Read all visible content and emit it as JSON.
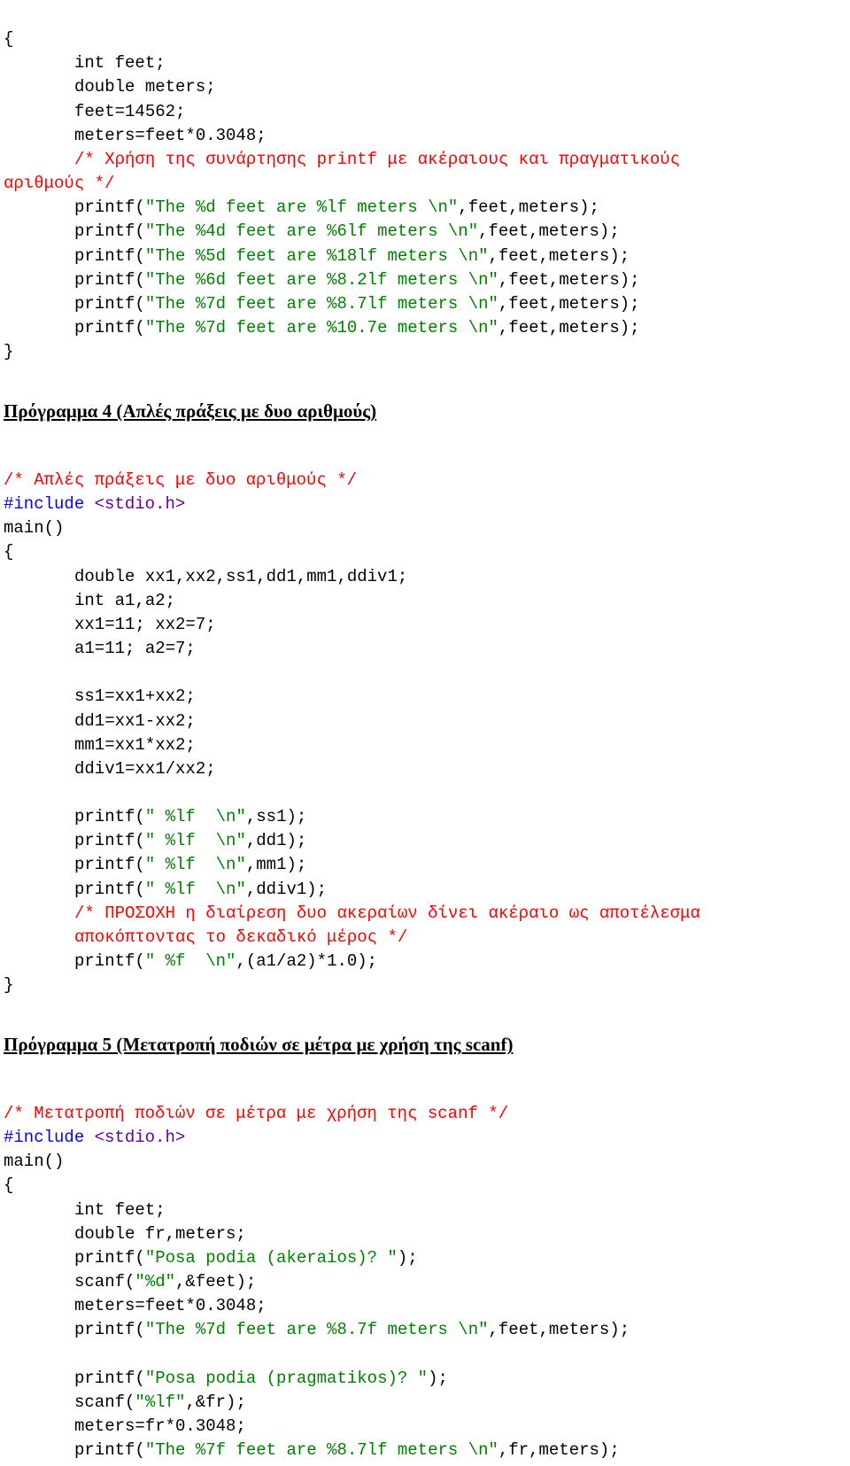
{
  "block1": {
    "open": "{",
    "l1": "int feet;",
    "l2": "double meters;",
    "l3": "feet=14562;",
    "l4": "meters=feet*0.3048;",
    "c1a": "/* Χρήση της συνάρτησης printf με ακέραιους και πραγματικούς",
    "c1b": "αριθμούς */",
    "l5a": "printf(",
    "l5b": "\"The %d feet are %lf meters \\n\"",
    "l5c": ",feet,meters);",
    "l6a": "printf(",
    "l6b": "\"The %4d feet are %6lf meters \\n\"",
    "l6c": ",feet,meters);",
    "l7a": "printf(",
    "l7b": "\"The %5d feet are %18lf meters \\n\"",
    "l7c": ",feet,meters);",
    "l8a": "printf(",
    "l8b": "\"The %6d feet are %8.2lf meters \\n\"",
    "l8c": ",feet,meters);",
    "l9a": "printf(",
    "l9b": "\"The %7d feet are %8.7lf meters \\n\"",
    "l9c": ",feet,meters);",
    "l10a": "printf(",
    "l10b": "\"The %7d feet are %10.7e meters \\n\"",
    "l10c": ",feet,meters);",
    "close": "}"
  },
  "heading4": "Πρόγραμμα 4 (Απλές πράξεις με δυο αριθμούς)",
  "block2": {
    "c1": "/* Απλές πράξεις με δυο αριθμούς */",
    "inc1": "#include ",
    "inc2": "<stdio.h>",
    "main": "main()",
    "open": "{",
    "l1": "double xx1,xx2,ss1,dd1,mm1,ddiv1;",
    "l2": "int a1,a2;",
    "l3": "xx1=11; xx2=7;",
    "l4": "a1=11; a2=7;",
    "l5": "ss1=xx1+xx2;",
    "l6": "dd1=xx1-xx2;",
    "l7": "mm1=xx1*xx2;",
    "l8": "ddiv1=xx1/xx2;",
    "p1a": "printf(",
    "p1b": "\" %lf  \\n\"",
    "p1c": ",ss1);",
    "p2a": "printf(",
    "p2b": "\" %lf  \\n\"",
    "p2c": ",dd1);",
    "p3a": "printf(",
    "p3b": "\" %lf  \\n\"",
    "p3c": ",mm1);",
    "p4a": "printf(",
    "p4b": "\" %lf  \\n\"",
    "p4c": ",ddiv1);",
    "c2a": "/* ΠΡΟΣΟΧΗ η διαίρεση δυο ακεραίων δίνει ακέραιο ως αποτέλεσμα",
    "c2b": "αποκόπτοντας το δεκαδικό μέρος */",
    "p5a": "printf(",
    "p5b": "\" %f  \\n\"",
    "p5c": ",(a1/a2)*1.0);",
    "close": "}"
  },
  "heading5": "Πρόγραμμα 5 (Μετατροπή ποδιών σε μέτρα με χρήση της scanf)",
  "block3": {
    "c1": "/* Μετατροπή ποδιών σε μέτρα με χρήση της scanf */",
    "inc1": "#include ",
    "inc2": "<stdio.h>",
    "main": "main()",
    "open": "{",
    "l1": "int feet;",
    "l2": "double fr,meters;",
    "p1a": "printf(",
    "p1b": "\"Posa podia (akeraios)? \"",
    "p1c": ");",
    "s1a": "scanf(",
    "s1b": "\"%d\"",
    "s1c": ",&feet);",
    "l3": "meters=feet*0.3048;",
    "p2a": "printf(",
    "p2b": "\"The %7d feet are %8.7f meters \\n\"",
    "p2c": ",feet,meters);",
    "p3a": "printf(",
    "p3b": "\"Posa podia (pragmatikos)? \"",
    "p3c": ");",
    "s2a": "scanf(",
    "s2b": "\"%lf\"",
    "s2c": ",&fr);",
    "l4": "meters=fr*0.3048;",
    "p4a": "printf(",
    "p4b": "\"The %7f feet are %8.7lf meters \\n\"",
    "p4c": ",fr,meters);"
  }
}
